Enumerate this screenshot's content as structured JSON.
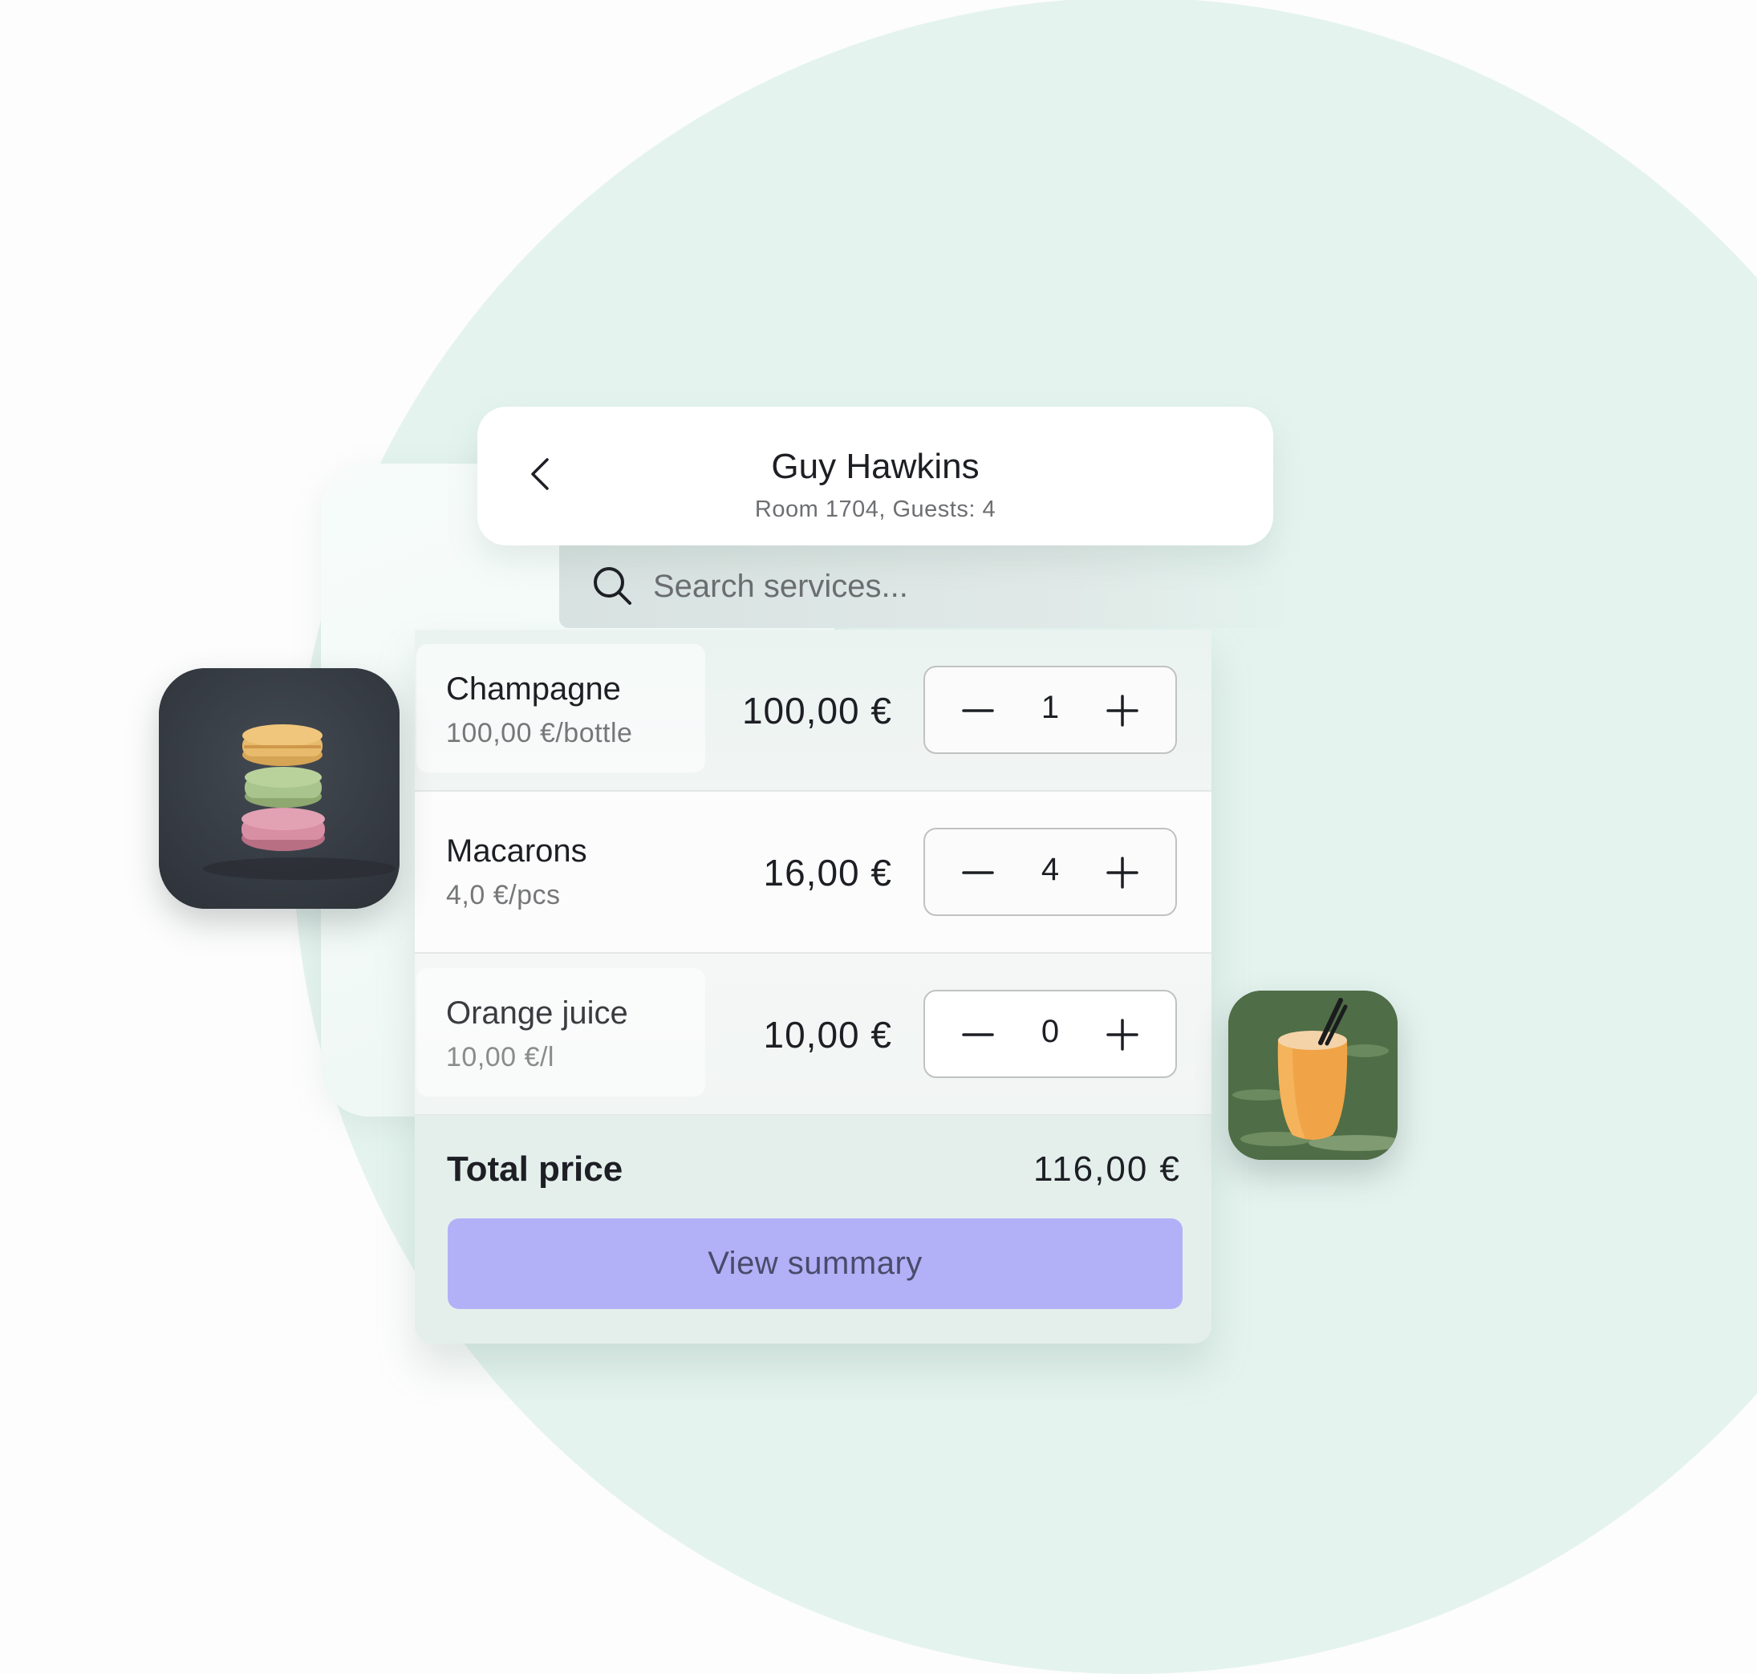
{
  "header": {
    "guest_name": "Guy Hawkins",
    "guest_meta": "Room 1704, Guests: 4",
    "back_icon": "chevron-left-icon"
  },
  "search": {
    "placeholder": "Search services...",
    "value": "",
    "icon": "search-icon"
  },
  "items": [
    {
      "name": "Champagne",
      "unit_price": "100,00 €/bottle",
      "total": "100,00 €",
      "quantity": "1"
    },
    {
      "name": "Macarons",
      "unit_price": "4,0 €/pcs",
      "total": "16,00 €",
      "quantity": "4"
    },
    {
      "name": "Orange juice",
      "unit_price": "10,00 €/l",
      "total": "10,00 €",
      "quantity": "0"
    }
  ],
  "stepper": {
    "decrement_icon": "minus-icon",
    "increment_icon": "plus-icon"
  },
  "total": {
    "label": "Total price",
    "value": "116,00 €"
  },
  "actions": {
    "view_summary": "View summary"
  },
  "images": [
    {
      "subject": "macarons-photo"
    },
    {
      "subject": "orange-juice-photo"
    }
  ],
  "colors": {
    "background_accent": "#e4f3ee",
    "button": "#b2b1f7",
    "text_primary": "#1d1f24",
    "text_secondary": "#767779"
  }
}
